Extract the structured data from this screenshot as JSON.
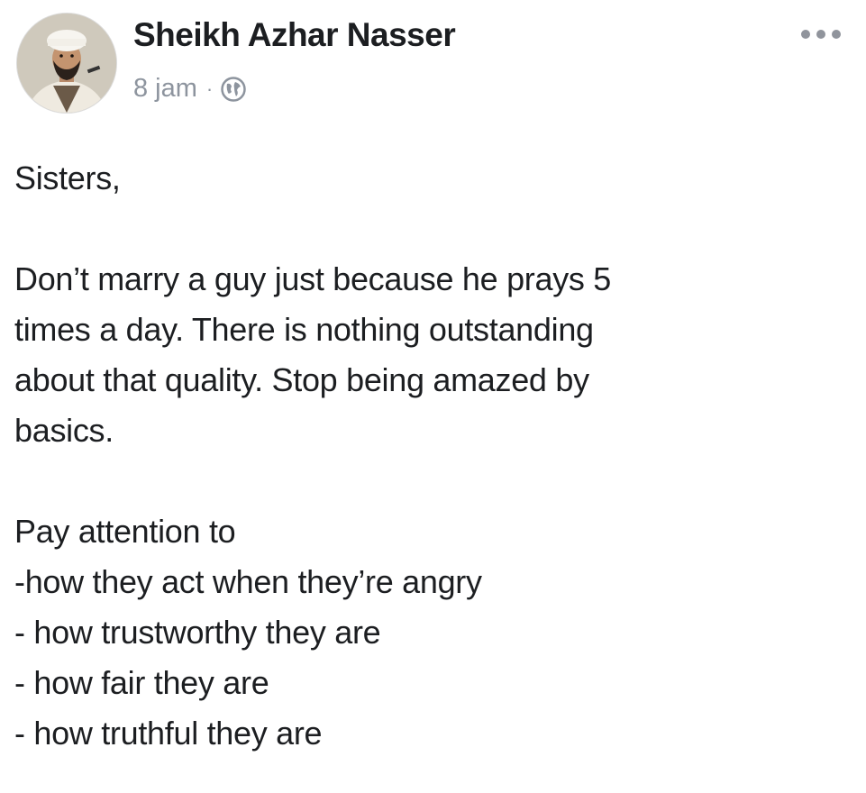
{
  "post": {
    "author": "Sheikh Azhar Nasser",
    "time": "8 jam",
    "separator": "·",
    "privacy_icon": "globe-icon",
    "more_icon": "more-options-icon",
    "greeting": "Sisters,",
    "paragraph_lines": [
      "Don’t marry a guy just because he prays 5",
      "times a day. There is nothing outstanding",
      "about that quality. Stop being amazed by",
      "basics."
    ],
    "list_intro": "Pay attention to",
    "list_items": [
      "-how they act when they’re angry",
      "- how trustworthy they are",
      "- how fair they are",
      "- how truthful they are"
    ]
  },
  "colors": {
    "text": "#1c1e21",
    "meta": "#8d949e",
    "icon": "#90949c"
  }
}
